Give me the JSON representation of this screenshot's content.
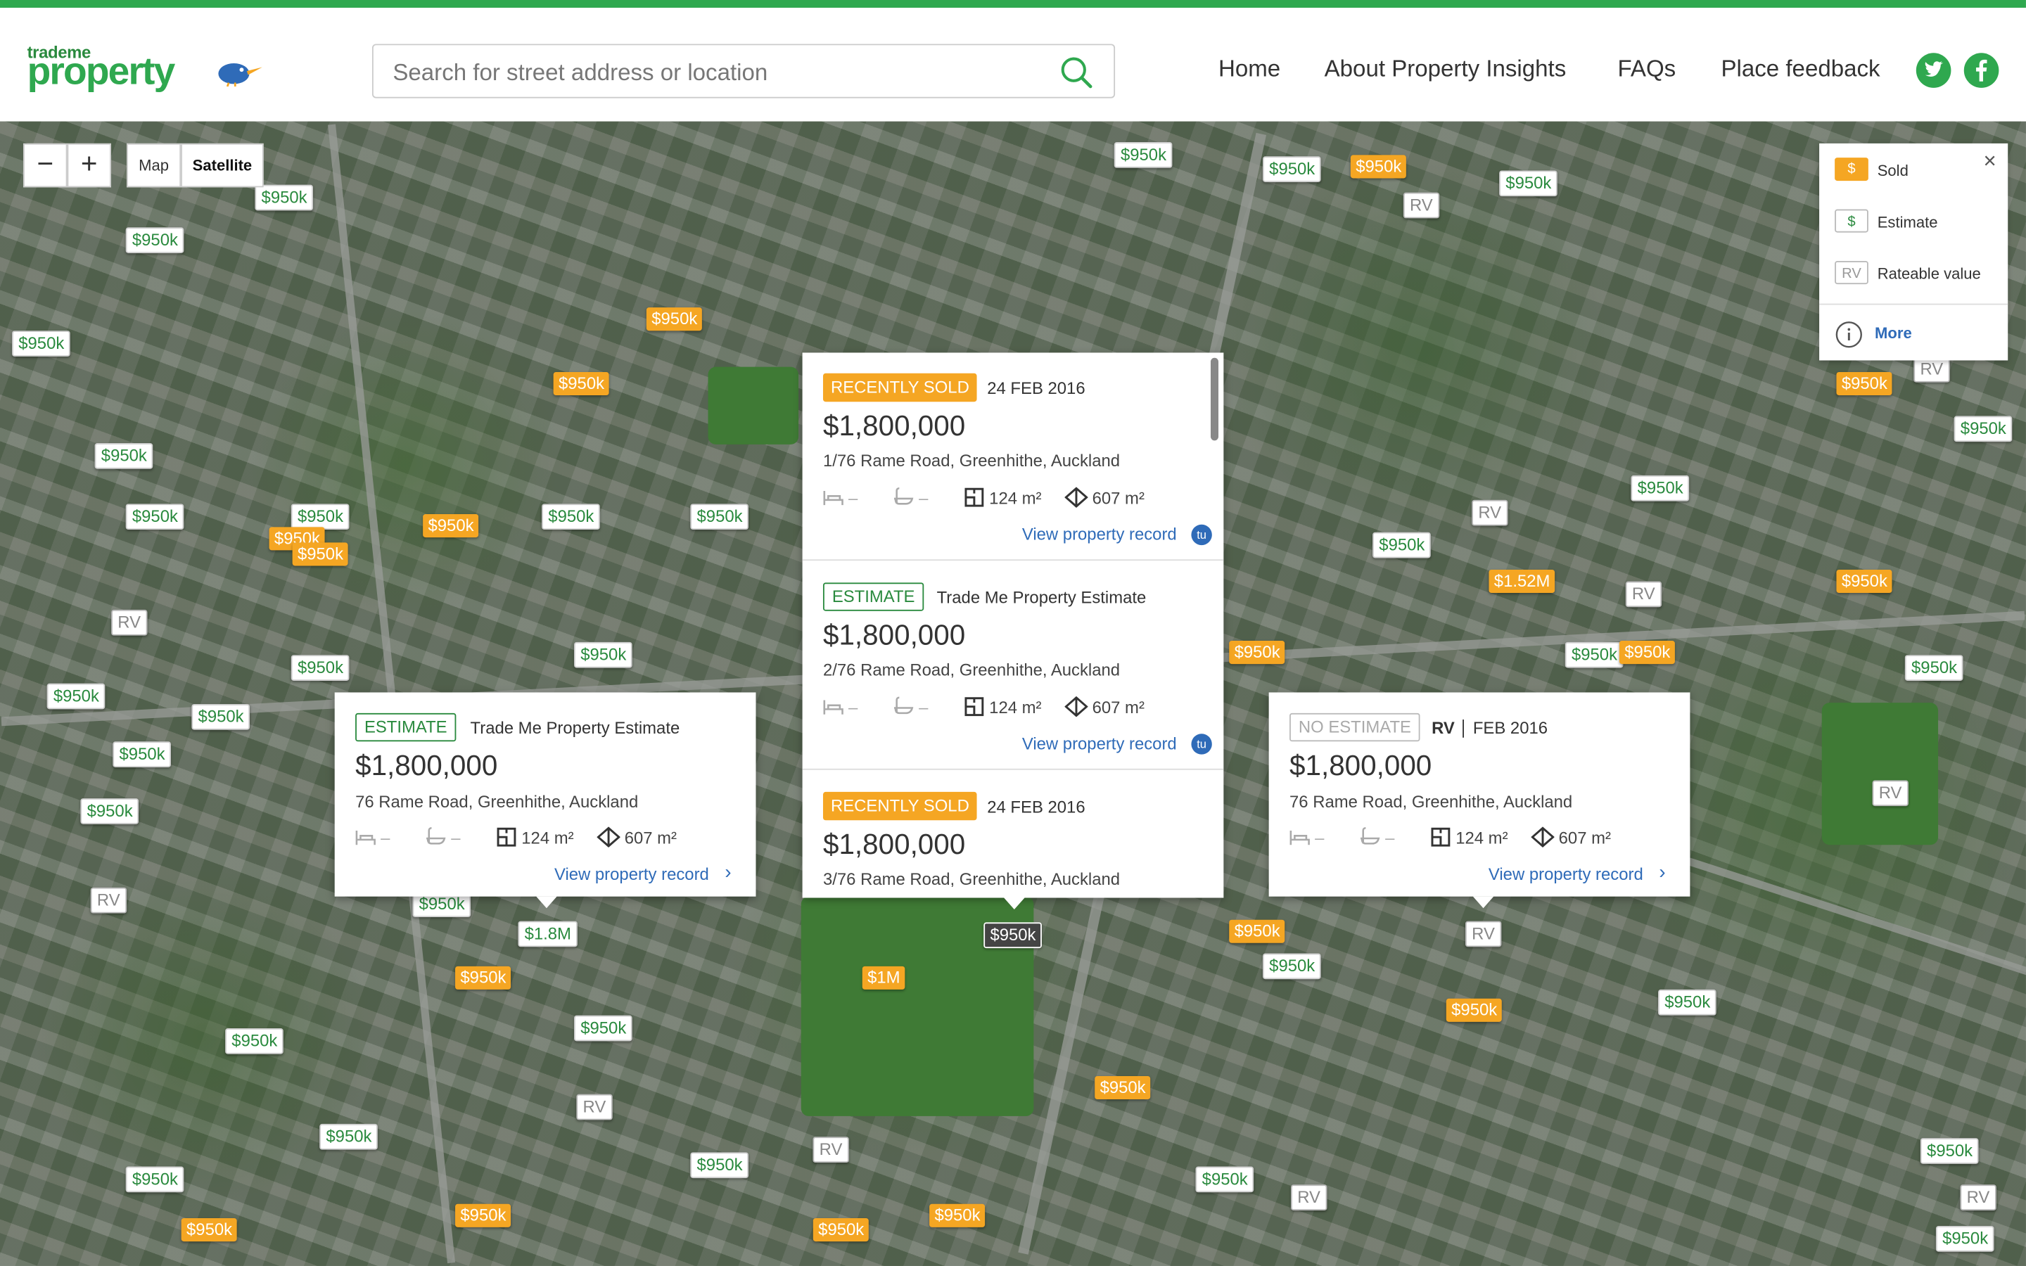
{
  "brand": {
    "small": "trademe",
    "big": "property"
  },
  "search": {
    "placeholder": "Search for street address or location"
  },
  "nav": [
    "Home",
    "About Property Insights",
    "FAQs",
    "Place feedback"
  ],
  "social": {
    "twitter": "twitter-icon",
    "facebook": "facebook-icon"
  },
  "colors": {
    "brand_green": "#2fa84f",
    "sold_orange": "#f5a623",
    "link_blue": "#2f6bb8"
  },
  "map_controls": {
    "zoom_out": "−",
    "zoom_in": "+",
    "map_label": "Map",
    "satellite_label": "Satellite",
    "active_type": "Satellite"
  },
  "legend": {
    "sold_icon": "$",
    "sold": "Sold",
    "estimate_icon": "$",
    "estimate": "Estimate",
    "rv_icon": "RV",
    "rateable": "Rateable value",
    "more": "More",
    "close": "×"
  },
  "popup_stack": [
    {
      "badge": "RECENTLY SOLD",
      "badge_type": "sold",
      "meta": "24 FEB 2016",
      "price": "$1,800,000",
      "address": "1/76 Rame Road, Greenhithe, Auckland",
      "beds": "–",
      "baths": "–",
      "floor": "124 m²",
      "land": "607 m²",
      "link": "View property record"
    },
    {
      "badge": "ESTIMATE",
      "badge_type": "estimate",
      "meta": "Trade Me Property Estimate",
      "price": "$1,800,000",
      "address": "2/76 Rame Road, Greenhithe, Auckland",
      "beds": "–",
      "baths": "–",
      "floor": "124 m²",
      "land": "607 m²",
      "link": "View property record"
    },
    {
      "badge": "RECENTLY SOLD",
      "badge_type": "sold",
      "meta": "24 FEB 2016",
      "price": "$1,800,000",
      "address": "3/76 Rame Road, Greenhithe, Auckland"
    }
  ],
  "popup_left": {
    "badge": "ESTIMATE",
    "meta": "Trade Me Property Estimate",
    "price": "$1,800,000",
    "address": "76 Rame Road, Greenhithe, Auckland",
    "beds": "–",
    "baths": "–",
    "floor": "124 m²",
    "land": "607 m²",
    "link": "View property record"
  },
  "popup_right": {
    "badge": "NO ESTIMATE",
    "rv": "RV",
    "meta": "FEB 2016",
    "price": "$1,800,000",
    "address": "76 Rame Road, Greenhithe, Auckland",
    "beds": "–",
    "baths": "–",
    "floor": "124 m²",
    "land": "607 m²",
    "link": "View property record"
  },
  "pins": [
    {
      "t": "e",
      "v": "$950k"
    },
    {
      "t": "e",
      "v": "$950k"
    },
    {
      "t": "e",
      "v": "$950k"
    },
    {
      "t": "e",
      "v": "$950k"
    },
    {
      "t": "e",
      "v": "$950k"
    },
    {
      "t": "e",
      "v": "$950k"
    },
    {
      "t": "e",
      "v": "$950k"
    },
    {
      "t": "e",
      "v": "$950k"
    },
    {
      "t": "e",
      "v": "$950k"
    },
    {
      "t": "e",
      "v": "$950k"
    },
    {
      "t": "e",
      "v": "$950k"
    },
    {
      "t": "e",
      "v": "$950k"
    },
    {
      "t": "e",
      "v": "$950k"
    },
    {
      "t": "e",
      "v": "$950k"
    },
    {
      "t": "e",
      "v": "$950k"
    },
    {
      "t": "e",
      "v": "$950k"
    },
    {
      "t": "e",
      "v": "$950k"
    },
    {
      "t": "e",
      "v": "$950k"
    },
    {
      "t": "e",
      "v": "$950k"
    },
    {
      "t": "e",
      "v": "$950k"
    },
    {
      "t": "e",
      "v": "$950k"
    },
    {
      "t": "e",
      "v": "$950k"
    },
    {
      "t": "e",
      "v": "$950k"
    },
    {
      "t": "e",
      "v": "$950k"
    },
    {
      "t": "e",
      "v": "$950k"
    },
    {
      "t": "e",
      "v": "$950k"
    },
    {
      "t": "e",
      "v": "$950k"
    },
    {
      "t": "e",
      "v": "$950k"
    },
    {
      "t": "e",
      "v": "$950k"
    },
    {
      "t": "e",
      "v": "$950k"
    },
    {
      "t": "e",
      "v": "$950k"
    },
    {
      "t": "e",
      "v": "$950k"
    },
    {
      "t": "e",
      "v": "$950k"
    },
    {
      "t": "e",
      "v": "$950k"
    },
    {
      "t": "e",
      "v": "$950k"
    },
    {
      "t": "e",
      "v": "$950k"
    },
    {
      "t": "e",
      "v": "$950k"
    },
    {
      "t": "e",
      "v": "$950k"
    },
    {
      "t": "e",
      "v": "$1.8M"
    },
    {
      "t": "s",
      "v": "$950k"
    },
    {
      "t": "s",
      "v": "$950k"
    },
    {
      "t": "s",
      "v": "$950k"
    },
    {
      "t": "s",
      "v": "$950k"
    },
    {
      "t": "s",
      "v": "$950k"
    },
    {
      "t": "s",
      "v": "$950k"
    },
    {
      "t": "s",
      "v": "$1.52M"
    },
    {
      "t": "s",
      "v": "$950k"
    },
    {
      "t": "s",
      "v": "$950k"
    },
    {
      "t": "s",
      "v": "$950k"
    },
    {
      "t": "s",
      "v": "$950k"
    },
    {
      "t": "s",
      "v": "$950k"
    },
    {
      "t": "s",
      "v": "$950k"
    },
    {
      "t": "s",
      "v": "$950k"
    },
    {
      "t": "s",
      "v": "$950k"
    },
    {
      "t": "s",
      "v": "$950k"
    },
    {
      "t": "s",
      "v": "$950k"
    },
    {
      "t": "s",
      "v": "$1M"
    },
    {
      "t": "s",
      "v": "$950k"
    },
    {
      "t": "s",
      "v": "$950k"
    },
    {
      "t": "r",
      "v": "RV"
    },
    {
      "t": "r",
      "v": "RV"
    },
    {
      "t": "r",
      "v": "RV"
    },
    {
      "t": "r",
      "v": "RV"
    },
    {
      "t": "r",
      "v": "RV"
    },
    {
      "t": "r",
      "v": "RV"
    },
    {
      "t": "r",
      "v": "RV"
    },
    {
      "t": "r",
      "v": "RV"
    },
    {
      "t": "r",
      "v": "RV"
    },
    {
      "t": "r",
      "v": "RV"
    },
    {
      "t": "r",
      "v": "RV"
    },
    {
      "t": "r",
      "v": "RV"
    },
    {
      "t": "r",
      "v": "RV"
    },
    {
      "t": "x",
      "v": "$950k"
    }
  ]
}
